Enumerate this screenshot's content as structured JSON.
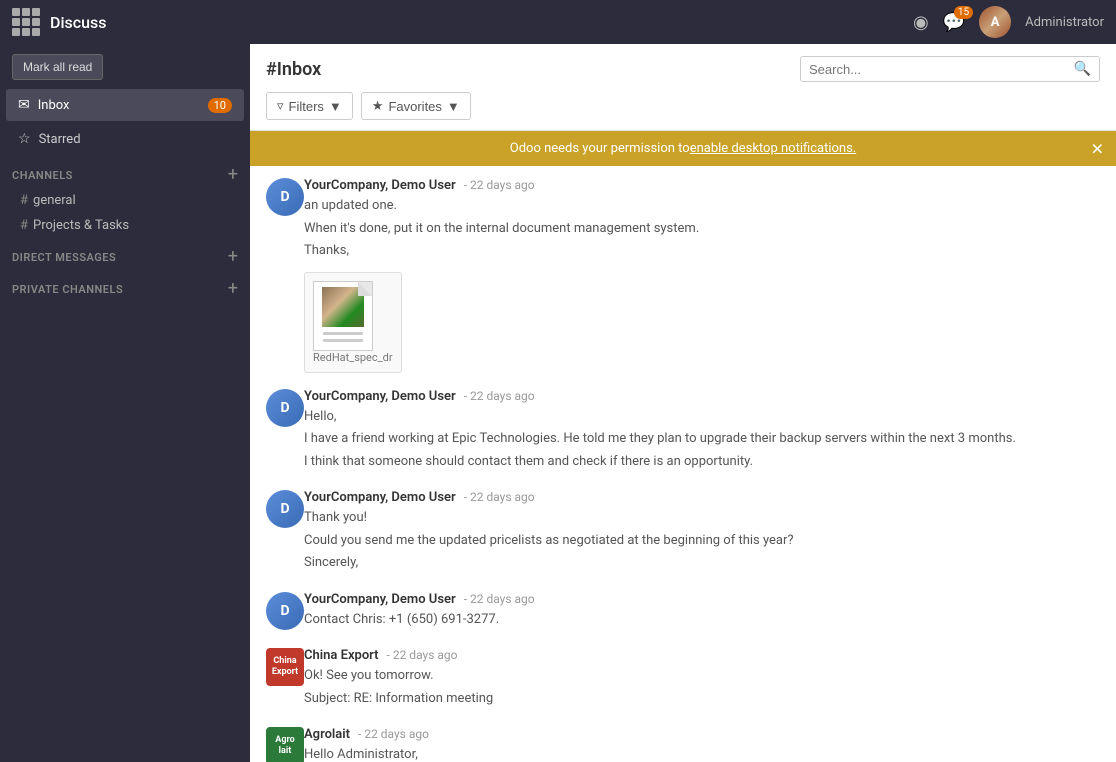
{
  "app": {
    "title": "Discuss"
  },
  "topnav": {
    "admin_label": "Administrator",
    "notification_badge": "15"
  },
  "sidebar": {
    "mark_all_read": "Mark all read",
    "inbox_label": "Inbox",
    "inbox_badge": "10",
    "starred_label": "Starred",
    "channels_section": "CHANNELS",
    "channels": [
      {
        "name": "general"
      },
      {
        "name": "Projects & Tasks"
      }
    ],
    "direct_messages_section": "DIRECT MESSAGES",
    "private_channels_section": "PRIVATE CHANNELS"
  },
  "header": {
    "title": "#Inbox",
    "search_placeholder": "Search...",
    "filters_btn": "Filters",
    "favorites_btn": "Favorites"
  },
  "banner": {
    "text": "Odoo needs your permission to ",
    "link": "enable desktop notifications."
  },
  "messages": [
    {
      "id": "msg1",
      "sender": "YourCompany, Demo User",
      "time": "22 days ago",
      "lines": [
        "an updated one.",
        "When it's done, put it on the internal document management system.",
        "Thanks,"
      ],
      "has_attachment": true,
      "attachment_name": "RedHat_spec_dr"
    },
    {
      "id": "msg2",
      "sender": "YourCompany, Demo User",
      "time": "22 days ago",
      "lines": [
        "Hello,",
        "I have a friend working at Epic Technologies. He told me they plan to upgrade their backup servers within the next 3 months.",
        "I think that someone should contact them and check if there is an opportunity."
      ]
    },
    {
      "id": "msg3",
      "sender": "YourCompany, Demo User",
      "time": "22 days ago",
      "lines": [
        "Thank you!",
        "Could you send me the updated pricelists as negotiated at the beginning of this year?",
        "Sincerely,"
      ]
    },
    {
      "id": "msg4",
      "sender": "YourCompany, Demo User",
      "time": "22 days ago",
      "lines": [
        "Contact Chris: +1 (650) 691-3277."
      ]
    },
    {
      "id": "msg5",
      "sender": "China Export",
      "time": "22 days ago",
      "lines": [
        "Ok! See you tomorrow.",
        "Subject: RE: Information meeting"
      ],
      "avatar_type": "china"
    },
    {
      "id": "msg6",
      "sender": "Agrolait",
      "time": "22 days ago",
      "lines": [
        "Hello Administrator,"
      ],
      "avatar_type": "agrolait"
    }
  ]
}
